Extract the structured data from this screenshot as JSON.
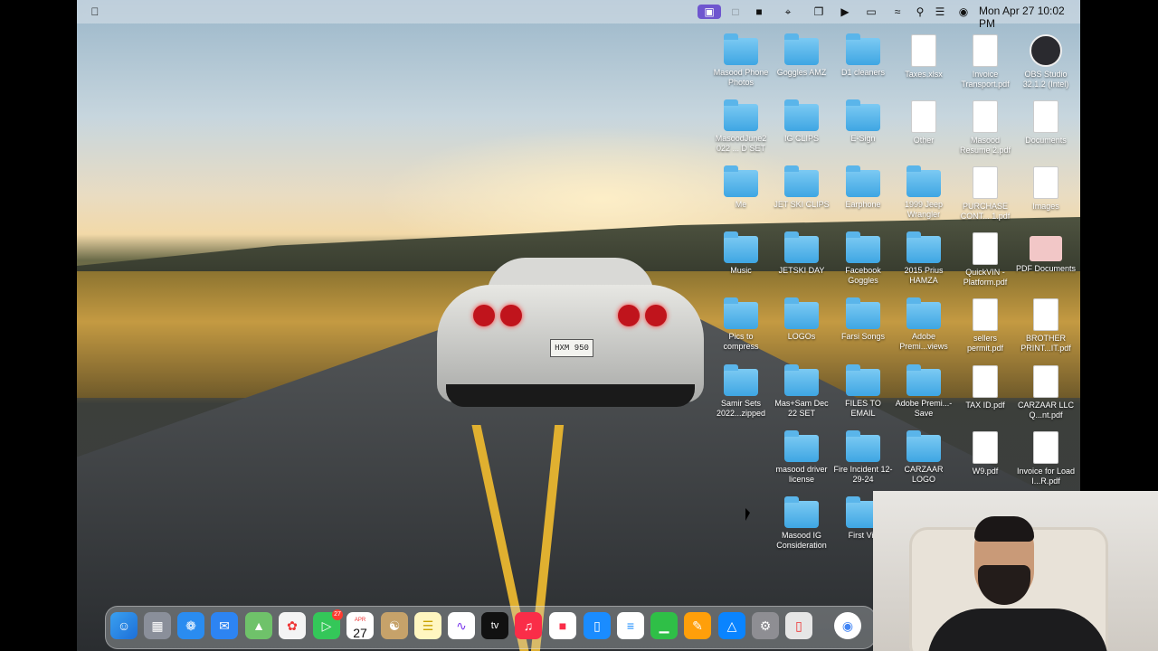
{
  "menubar": {
    "apple": "",
    "datetime": "Mon Apr 27  10:02 PM"
  },
  "wallpaper": {
    "car_plate": "HXM 950"
  },
  "desktop": {
    "icons": [
      {
        "label": "Masood Phone Photos",
        "kind": "folder"
      },
      {
        "label": "Goggles AMZ",
        "kind": "folder"
      },
      {
        "label": "D1 cleaners",
        "kind": "folder"
      },
      {
        "label": "Taxes.xlsx",
        "kind": "file"
      },
      {
        "label": "Invoice Transport.pdf",
        "kind": "file"
      },
      {
        "label": "OBS Studio 32.1.2 (Intel)",
        "kind": "app"
      },
      {
        "label": "MasoodJune2 022 ... D SET",
        "kind": "folder"
      },
      {
        "label": "IG CLIPS",
        "kind": "folder"
      },
      {
        "label": "E-Sign",
        "kind": "folder"
      },
      {
        "label": "Other",
        "kind": "file"
      },
      {
        "label": "Masood Resume 2.pdf",
        "kind": "file"
      },
      {
        "label": "Documents",
        "kind": "file"
      },
      {
        "label": "Me",
        "kind": "folder"
      },
      {
        "label": "JET SKI CLIPS",
        "kind": "folder"
      },
      {
        "label": "Earphone",
        "kind": "folder"
      },
      {
        "label": "1999 Jeep Wrangler",
        "kind": "folder"
      },
      {
        "label": "PURCHASE CONT... 1.pdf",
        "kind": "file"
      },
      {
        "label": "Images",
        "kind": "file"
      },
      {
        "label": "Music",
        "kind": "folder"
      },
      {
        "label": "JETSKI DAY",
        "kind": "folder"
      },
      {
        "label": "Facebook Goggles",
        "kind": "folder"
      },
      {
        "label": "2015 Prius HAMZA",
        "kind": "folder"
      },
      {
        "label": "QuickVIN - Platform.pdf",
        "kind": "file"
      },
      {
        "label": "PDF Documents",
        "kind": "pdf-folder"
      },
      {
        "label": "Pics to compress",
        "kind": "folder"
      },
      {
        "label": "LOGOs",
        "kind": "folder"
      },
      {
        "label": "Farsi Songs",
        "kind": "folder"
      },
      {
        "label": "Adobe Premi...views",
        "kind": "folder"
      },
      {
        "label": "sellers permit.pdf",
        "kind": "file"
      },
      {
        "label": "BROTHER PRINT...IT.pdf",
        "kind": "file"
      },
      {
        "label": "Samir Sets 2022...zipped",
        "kind": "folder"
      },
      {
        "label": "Mas+Sam Dec 22 SET",
        "kind": "folder"
      },
      {
        "label": "FILES TO EMAIL",
        "kind": "folder"
      },
      {
        "label": "Adobe Premi...-Save",
        "kind": "folder"
      },
      {
        "label": "TAX ID.pdf",
        "kind": "file"
      },
      {
        "label": "CARZAAR LLC Q...nt.pdf",
        "kind": "file"
      },
      {
        "label": "masood driver license",
        "kind": "folder"
      },
      {
        "label": "Fire Incident 12-29-24",
        "kind": "folder"
      },
      {
        "label": "CARZAAR LOGO",
        "kind": "folder"
      },
      {
        "label": "W9.pdf",
        "kind": "file"
      },
      {
        "label": "Invoice for Load I...R.pdf",
        "kind": "file"
      },
      {
        "label": "Masood IG Consideration",
        "kind": "folder"
      },
      {
        "label": "First Vid",
        "kind": "folder"
      }
    ]
  },
  "dock": {
    "calendar_month": "APR",
    "calendar_day": "27",
    "facetime_badge": "27",
    "tv_label": "tv"
  }
}
